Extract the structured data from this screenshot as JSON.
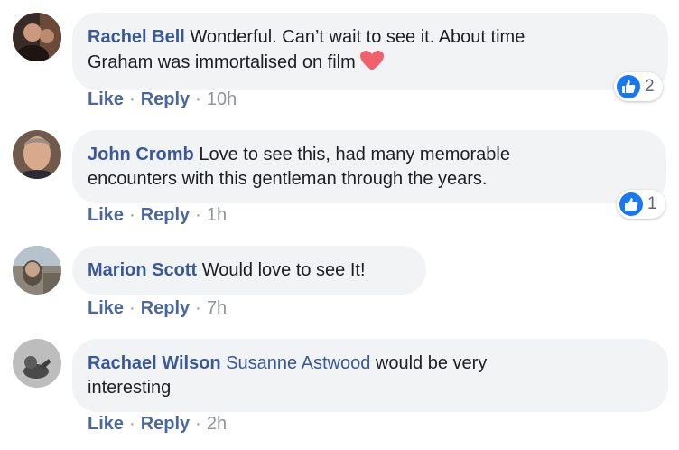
{
  "comments": [
    {
      "author": "Rachel Bell",
      "text_line1": "Wonderful. Can’t wait to see it. About time",
      "text_line2": "Graham was immortalised on film",
      "emoji": "heart-emoji",
      "actions": {
        "like": "Like",
        "reply": "Reply",
        "sep": "·",
        "time": "10h"
      },
      "reaction_count": "2"
    },
    {
      "author": "John Cromb",
      "text_line1": "Love to see this, had many memorable",
      "text_line2": "encounters with this gentleman through the years.",
      "actions": {
        "like": "Like",
        "reply": "Reply",
        "sep": "·",
        "time": "1h"
      },
      "reaction_count": "1"
    },
    {
      "author": "Marion Scott",
      "text_line1": "Would love to see It!",
      "actions": {
        "like": "Like",
        "reply": "Reply",
        "sep": "·",
        "time": "7h"
      }
    },
    {
      "author": "Rachael Wilson",
      "mention": "Susanne Astwood",
      "text_line1": "would be very",
      "text_line2": "interesting",
      "actions": {
        "like": "Like",
        "reply": "Reply",
        "sep": "·",
        "time": "2h"
      }
    }
  ],
  "colors": {
    "link": "#385898",
    "bubble": "#f2f3f5",
    "like_blue": "#1877f2",
    "meta_gray": "#90949c"
  }
}
